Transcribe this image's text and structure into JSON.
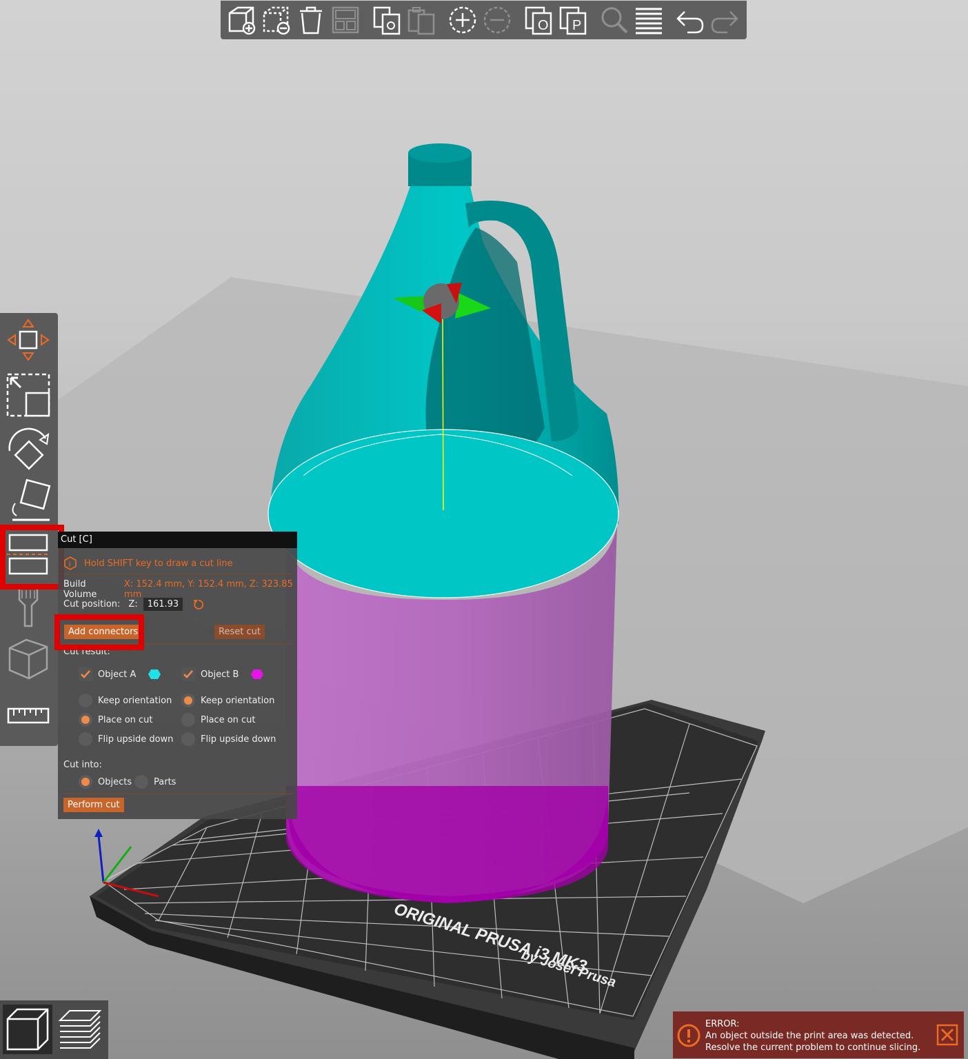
{
  "toolbar": {
    "items": [
      "add-object-icon",
      "delete-object-icon",
      "delete-all-icon",
      "arrange-icon",
      "copy-icon",
      "paste-icon",
      "add-instance-icon",
      "remove-instance-icon",
      "split-objects-icon",
      "split-parts-icon",
      "search-icon",
      "layers-editing-icon",
      "undo-icon",
      "redo-icon"
    ]
  },
  "left_toolbar": {
    "items": [
      "move-icon",
      "scale-icon",
      "rotate-icon",
      "place-on-face-icon",
      "cut-icon",
      "paint-icon",
      "seam-icon",
      "measure-icon"
    ]
  },
  "cut_panel": {
    "title": "Cut [C]",
    "hint": "Hold SHIFT key to draw a cut line",
    "build_volume_label": "Build Volume",
    "build_volume_value": "X: 152.4 mm,  Y: 152.4 mm,  Z: 323.85 mm",
    "cut_position_label": "Cut position:",
    "z_label": "Z:",
    "z_value": "161.93",
    "add_connectors": "Add connectors",
    "reset_cut": "Reset cut",
    "cut_result_label": "Cut result:",
    "object_a": "Object A",
    "object_b": "Object B",
    "object_a_color": "#1fe3e3",
    "object_b_color": "#e614e6",
    "keep_orientation": "Keep orientation",
    "place_on_cut": "Place on cut",
    "flip_upside_down": "Flip upside down",
    "cut_into_label": "Cut into:",
    "objects": "Objects",
    "parts": "Parts",
    "perform_cut": "Perform cut"
  },
  "bed": {
    "line1": "ORIGINAL PRUSA i3 MK3",
    "line2": "by Josef Prusa"
  },
  "error": {
    "title": "ERROR:",
    "line1": "An object outside the print area was detected.",
    "line2": "Resolve the current problem to continue slicing."
  },
  "view_toggle": {
    "items": [
      "3d-view-icon",
      "preview-icon"
    ]
  },
  "colors": {
    "accent": "#ed6b21",
    "highlight": "#e10000",
    "upper_part": "#00a8a8",
    "lower_part": "#b060b8"
  }
}
